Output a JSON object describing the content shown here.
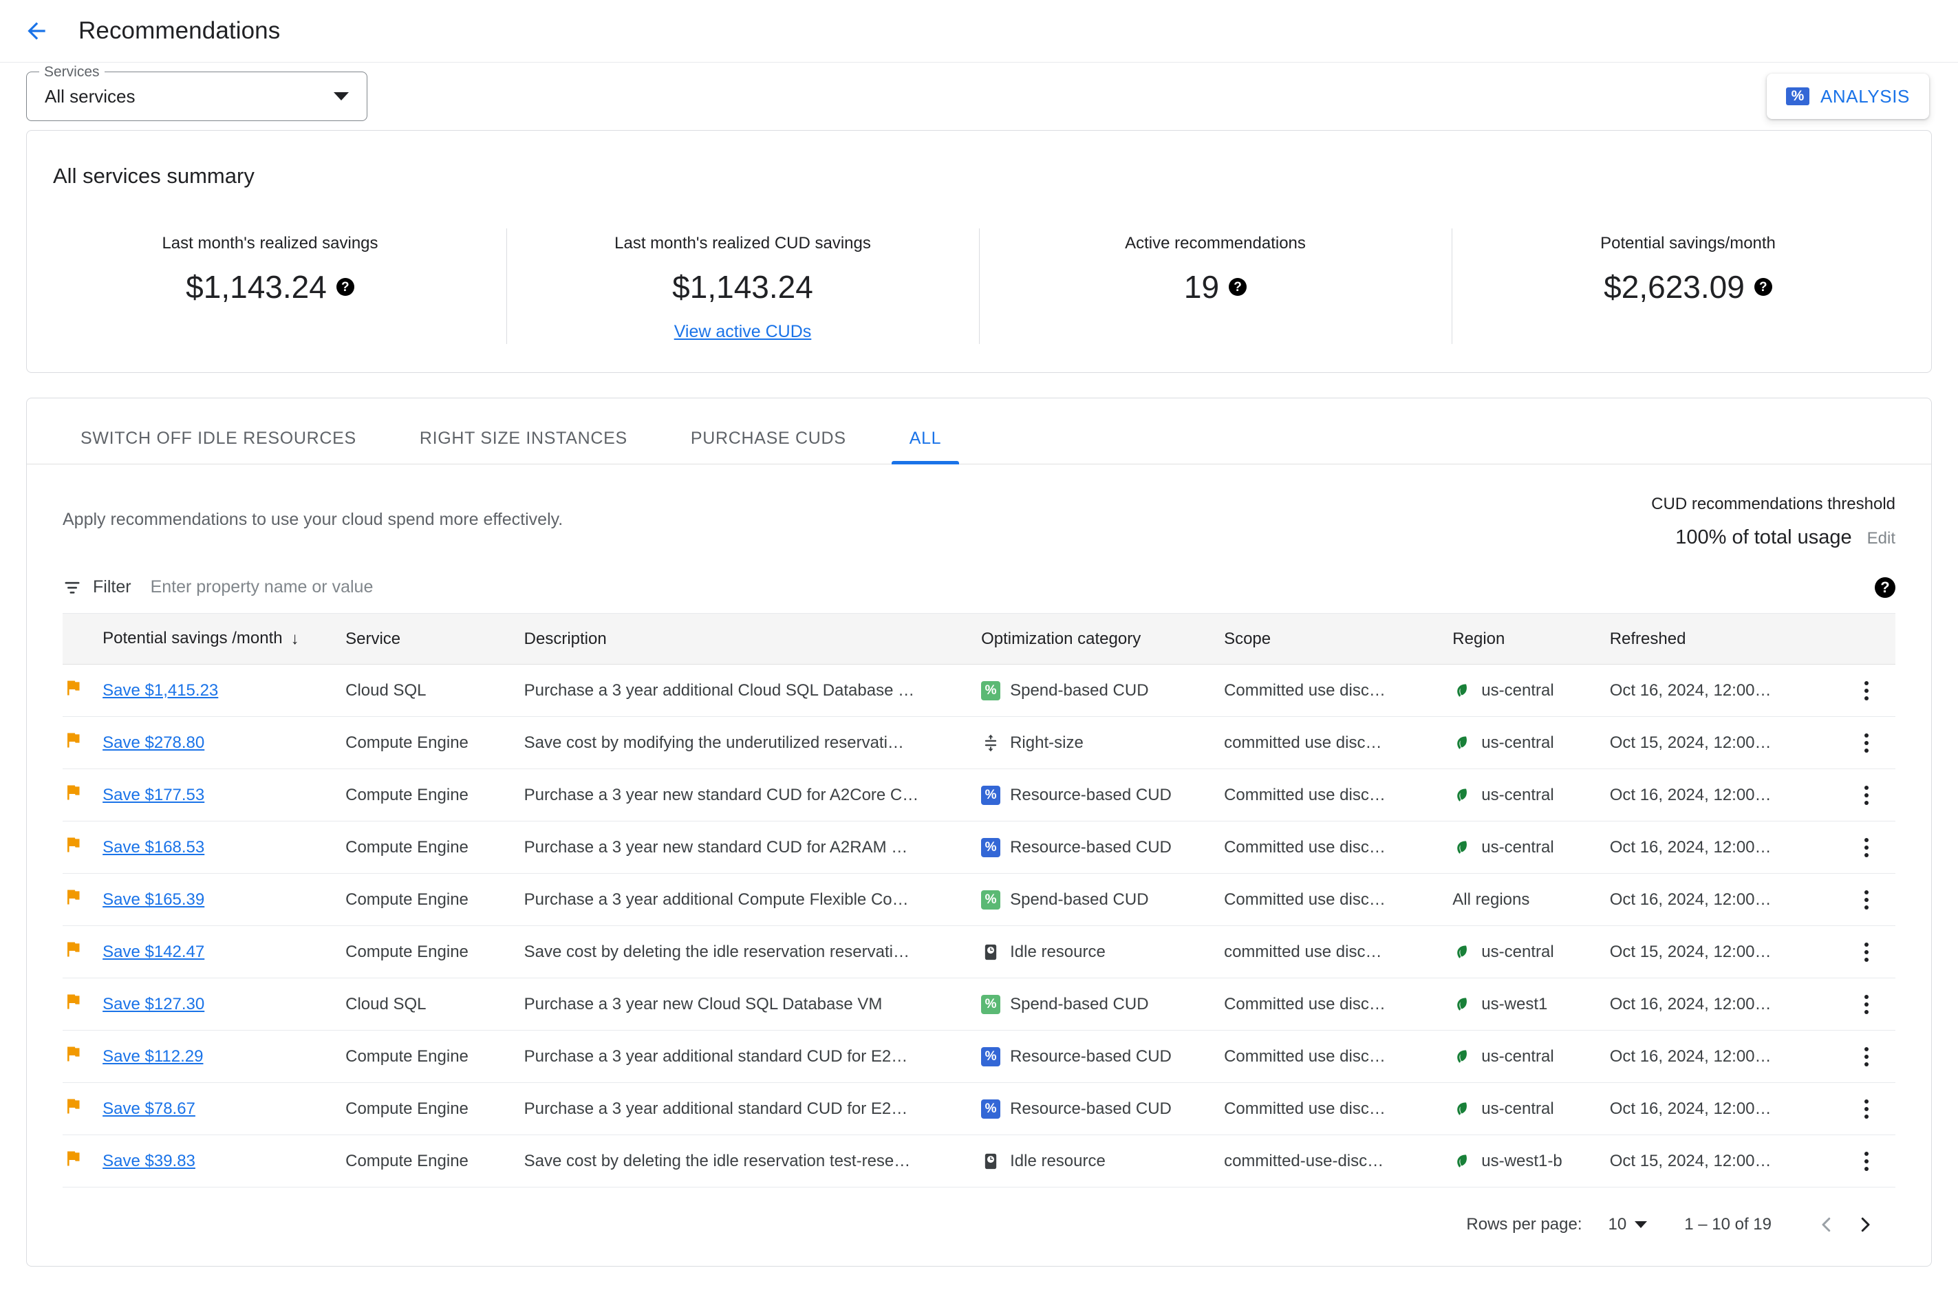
{
  "header": {
    "back_icon": "arrow-back-icon",
    "title": "Recommendations"
  },
  "toolstrip": {
    "services_legend": "Services",
    "services_value": "All services",
    "analysis_label": "ANALYSIS",
    "analysis_icon": "percent-ticket-icon"
  },
  "summary": {
    "title": "All services summary",
    "metrics": [
      {
        "label": "Last month's realized savings",
        "value": "$1,143.24",
        "help": "?",
        "link": ""
      },
      {
        "label": "Last month's realized CUD savings",
        "value": "$1,143.24",
        "help": "",
        "link": "View active CUDs"
      },
      {
        "label": "Active recommendations",
        "value": "19",
        "help": "?",
        "link": ""
      },
      {
        "label": "Potential savings/month",
        "value": "$2,623.09",
        "help": "?",
        "link": ""
      }
    ]
  },
  "tabs": [
    {
      "label": "SWITCH OFF IDLE RESOURCES",
      "active": false
    },
    {
      "label": "RIGHT SIZE INSTANCES",
      "active": false
    },
    {
      "label": "PURCHASE CUDS",
      "active": false
    },
    {
      "label": "ALL",
      "active": true
    }
  ],
  "panel": {
    "description": "Apply recommendations to use your cloud spend more effectively.",
    "threshold_label": "CUD recommendations threshold",
    "threshold_value": "100% of total usage",
    "threshold_edit": "Edit"
  },
  "filter": {
    "icon": "filter-icon",
    "label": "Filter",
    "placeholder": "Enter property name or value",
    "help_icon": "help-icon"
  },
  "table": {
    "columns": [
      "Potential savings /month",
      "Service",
      "Description",
      "Optimization category",
      "Scope",
      "Region",
      "Refreshed"
    ],
    "sort_arrow": "↓",
    "rows": [
      {
        "flag": "flag-icon",
        "savings": "Save $1,415.23",
        "service": "Cloud SQL",
        "description": "Purchase a 3 year additional Cloud SQL Database …",
        "category": "Spend-based CUD",
        "category_icon": "percent-green-icon",
        "scope": "Committed use disc…",
        "region": "us-central",
        "region_icon": "leaf-icon",
        "refreshed": "Oct 16, 2024, 12:00…"
      },
      {
        "flag": "flag-icon",
        "savings": "Save $278.80",
        "service": "Compute Engine",
        "description": "Save cost by modifying the underutilized reservati…",
        "category": "Right-size",
        "category_icon": "right-size-icon",
        "scope": "committed use disc…",
        "region": "us-central",
        "region_icon": "leaf-icon",
        "refreshed": "Oct 15, 2024, 12:00…"
      },
      {
        "flag": "flag-icon",
        "savings": "Save $177.53",
        "service": "Compute Engine",
        "description": "Purchase a 3 year new standard CUD for A2Core C…",
        "category": "Resource-based CUD",
        "category_icon": "percent-blue-icon",
        "scope": "Committed use disc…",
        "region": "us-central",
        "region_icon": "leaf-icon",
        "refreshed": "Oct 16, 2024, 12:00…"
      },
      {
        "flag": "flag-icon",
        "savings": "Save $168.53",
        "service": "Compute Engine",
        "description": "Purchase a 3 year new standard CUD for A2RAM …",
        "category": "Resource-based CUD",
        "category_icon": "percent-blue-icon",
        "scope": "Committed use disc…",
        "region": "us-central",
        "region_icon": "leaf-icon",
        "refreshed": "Oct 16, 2024, 12:00…"
      },
      {
        "flag": "flag-icon",
        "savings": "Save $165.39",
        "service": "Compute Engine",
        "description": "Purchase a 3 year additional Compute Flexible Co…",
        "category": "Spend-based CUD",
        "category_icon": "percent-green-icon",
        "scope": "Committed use disc…",
        "region": "All regions",
        "region_icon": "",
        "refreshed": "Oct 16, 2024, 12:00…"
      },
      {
        "flag": "flag-icon",
        "savings": "Save $142.47",
        "service": "Compute Engine",
        "description": "Save cost by deleting the idle reservation reservati…",
        "category": "Idle resource",
        "category_icon": "idle-resource-icon",
        "scope": "committed use disc…",
        "region": "us-central",
        "region_icon": "leaf-icon",
        "refreshed": "Oct 15, 2024, 12:00…"
      },
      {
        "flag": "flag-icon",
        "savings": "Save $127.30",
        "service": "Cloud SQL",
        "description": "Purchase a 3 year new Cloud SQL Database VM",
        "category": "Spend-based CUD",
        "category_icon": "percent-green-icon",
        "scope": "Committed use disc…",
        "region": "us-west1",
        "region_icon": "leaf-icon",
        "refreshed": "Oct 16, 2024, 12:00…"
      },
      {
        "flag": "flag-icon",
        "savings": "Save $112.29",
        "service": "Compute Engine",
        "description": "Purchase a 3 year additional standard CUD for E2…",
        "category": "Resource-based CUD",
        "category_icon": "percent-blue-icon",
        "scope": "Committed use disc…",
        "region": "us-central",
        "region_icon": "leaf-icon",
        "refreshed": "Oct 16, 2024, 12:00…"
      },
      {
        "flag": "flag-icon",
        "savings": "Save $78.67",
        "service": "Compute Engine",
        "description": "Purchase a 3 year additional standard CUD for E2…",
        "category": "Resource-based CUD",
        "category_icon": "percent-blue-icon",
        "scope": "Committed use disc…",
        "region": "us-central",
        "region_icon": "leaf-icon",
        "refreshed": "Oct 16, 2024, 12:00…"
      },
      {
        "flag": "flag-icon",
        "savings": "Save $39.83",
        "service": "Compute Engine",
        "description": "Save cost by deleting the idle reservation test-rese…",
        "category": "Idle resource",
        "category_icon": "idle-resource-icon",
        "scope": "committed-use-disc…",
        "region": "us-west1-b",
        "region_icon": "leaf-icon",
        "refreshed": "Oct 15, 2024, 12:00…"
      }
    ]
  },
  "pagination": {
    "rows_per_page_label": "Rows per page:",
    "rows_per_page_value": "10",
    "range": "1 – 10 of 19",
    "prev_icon": "chevron-left-icon",
    "next_icon": "chevron-right-icon"
  },
  "colors": {
    "accent_blue": "#1a73e8",
    "flag_orange": "#f29900",
    "cud_green": "#5bb974",
    "cud_blue": "#3367d6",
    "leaf_green": "#188038"
  }
}
